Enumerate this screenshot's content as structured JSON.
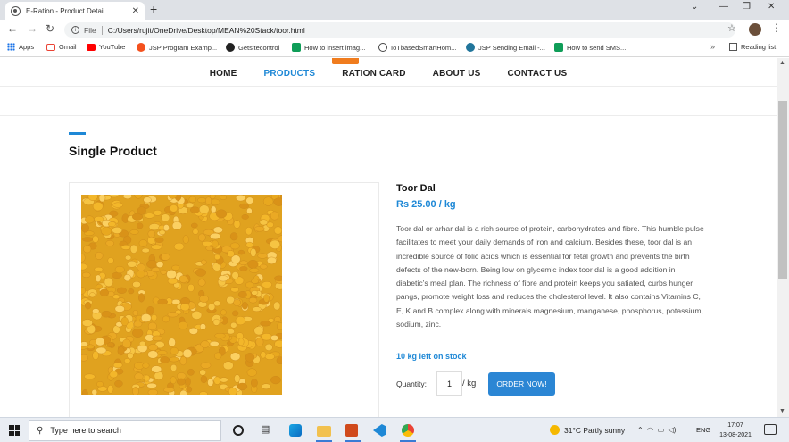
{
  "browser": {
    "tab_title": "E-Ration - Product Detail",
    "tab_close": "✕",
    "new_tab": "+",
    "url_prefix": "File",
    "url": "C:/Users/rujit/OneDrive/Desktop/MEAN%20Stack/toor.html",
    "bookmarks": [
      {
        "label": "Apps",
        "icon": "apps-icon",
        "color": "#1a73e8"
      },
      {
        "label": "Gmail",
        "icon": "gmail-icon",
        "color": "#ea4335"
      },
      {
        "label": "YouTube",
        "icon": "youtube-icon",
        "color": "#ff0000"
      },
      {
        "label": "JSP Program Examp...",
        "icon": "site-icon",
        "color": "#f4511e"
      },
      {
        "label": "Getsitecontrol",
        "icon": "getsitecontrol-icon",
        "color": "#222222"
      },
      {
        "label": "How to insert imag...",
        "icon": "site-icon",
        "color": "#0f9d58"
      },
      {
        "label": "IoTbasedSmartHom...",
        "icon": "globe-icon",
        "color": "#444444"
      },
      {
        "label": "JSP Sending Email -...",
        "icon": "wordpress-icon",
        "color": "#21759b"
      },
      {
        "label": "How to send SMS...",
        "icon": "site-icon",
        "color": "#0f9d58"
      }
    ],
    "bookmarks_more": "»",
    "reading_list": "Reading list"
  },
  "site": {
    "nav": [
      "HOME",
      "PRODUCTS",
      "RATION CARD",
      "ABOUT US",
      "CONTACT US"
    ],
    "active_nav": "PRODUCTS",
    "section_title": "Single Product",
    "accent_color": "#1e88d6",
    "brand_orange": "#f07c1e"
  },
  "product": {
    "name": "Toor Dal",
    "price": "Rs 25.00 / kg",
    "description": "Toor dal or arhar dal is a rich source of protein, carbohydrates and fibre. This humble pulse facilitates to meet your daily demands of iron and calcium. Besides these, toor dal is an incredible source of folic acids which is essential for fetal growth and prevents the birth defects of the new-born. Being low on glycemic index toor dal is a good addition in diabetic’s meal plan. The richness of fibre and protein keeps you satiated, curbs hunger pangs, promote weight loss and reduces the cholesterol level. It also contains Vitamins C, E, K and B complex along with minerals magnesium, manganese, phosphorus, potassium, sodium, zinc.",
    "stock": "10 kg left on stock",
    "quantity_label": "Quantity:",
    "quantity_value": "1",
    "unit": "/ kg",
    "order_button": "ORDER NOW!"
  },
  "taskbar": {
    "search_placeholder": "Type here to search",
    "weather": "31°C  Partly sunny",
    "language": "ENG",
    "time": "17:07",
    "date": "13-08-2021"
  }
}
